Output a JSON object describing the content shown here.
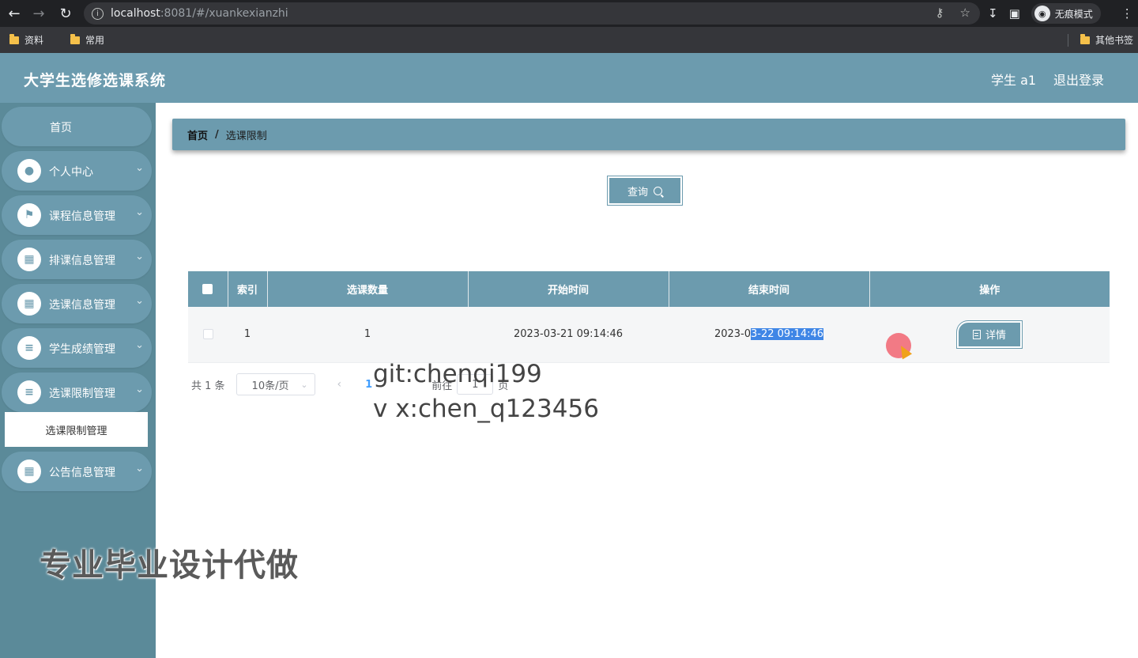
{
  "browser": {
    "url_host": "localhost",
    "url_rest": ":8081/#/xuankexianzhi",
    "incognito_label": "无痕模式",
    "bookmarks": [
      "资料",
      "常用"
    ],
    "other_bookmarks": "其他书签"
  },
  "header": {
    "title": "大学生选修选课系统",
    "user": "学生 a1",
    "logout": "退出登录"
  },
  "sidebar": {
    "items": [
      {
        "label": "首页",
        "icon": "home"
      },
      {
        "label": "个人中心",
        "icon": "user-icon"
      },
      {
        "label": "课程信息管理",
        "icon": "flag-icon"
      },
      {
        "label": "排课信息管理",
        "icon": "grid-icon"
      },
      {
        "label": "选课信息管理",
        "icon": "grid-icon"
      },
      {
        "label": "学生成绩管理",
        "icon": "list-icon"
      },
      {
        "label": "选课限制管理",
        "icon": "sliders-icon"
      },
      {
        "label": "公告信息管理",
        "icon": "grid-icon"
      }
    ],
    "submenu": "选课限制管理"
  },
  "breadcrumb": {
    "home": "首页",
    "separator": "/",
    "current": "选课限制"
  },
  "search": {
    "query_label": "查询"
  },
  "table": {
    "headers": [
      "索引",
      "选课数量",
      "开始时间",
      "结束时间",
      "操作"
    ],
    "rows": [
      {
        "index": "1",
        "count": "1",
        "start": "2023-03-21 09:14:46",
        "end_plain": "2023-0",
        "end_selected": "3-22 09:14:46",
        "action": "详情"
      }
    ]
  },
  "pagination": {
    "total": "共 1 条",
    "page_size": "10条/页",
    "current_page": "1",
    "goto": "前往",
    "goto_value": "1",
    "page_unit": "页"
  },
  "overlays": {
    "git": "git:chenqi199",
    "wx": "v x:chen_q123456",
    "ad": "专业毕业设计代做"
  },
  "colors": {
    "accent": "#6c9bae",
    "sidebar": "#5b8a99",
    "selection": "#3f86e6"
  }
}
